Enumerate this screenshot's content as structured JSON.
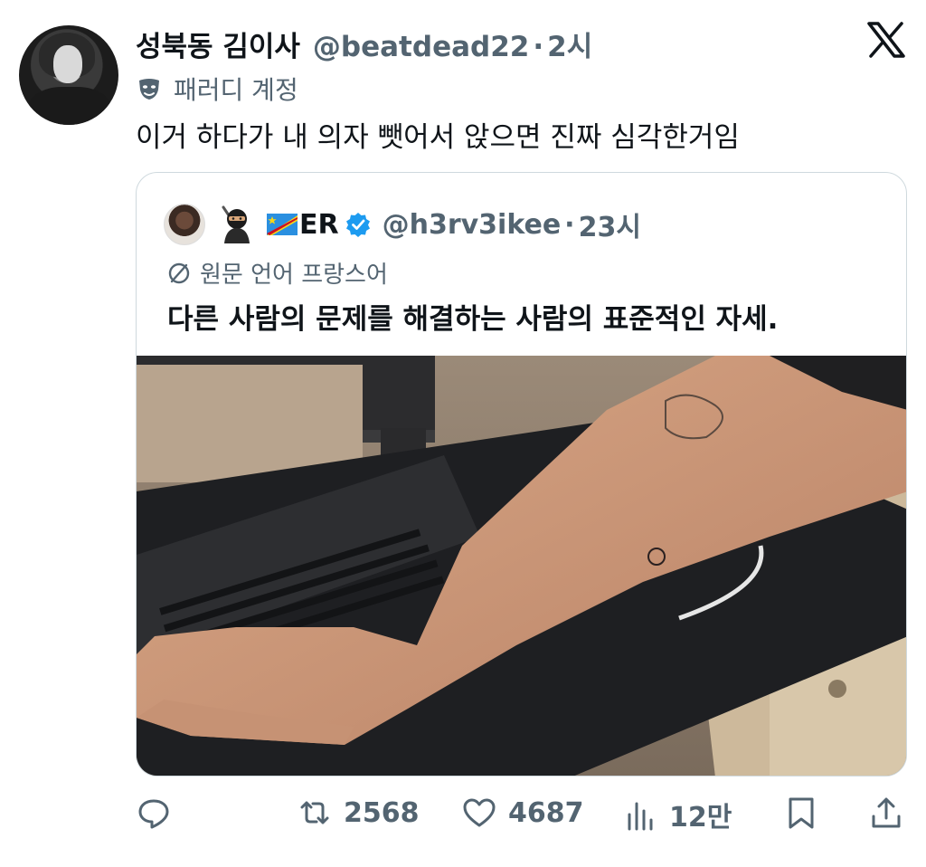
{
  "author": {
    "name": "성북동 김이사",
    "handle": "@beatdead22",
    "separator": "·",
    "time": "2시",
    "label": "패러디 계정"
  },
  "tweet": {
    "text": "이거 하다가 내 의자 뺏어서 앉으면 진짜 심각한거임"
  },
  "quoted": {
    "name": "ER",
    "handle": "@h3rv3ikee",
    "separator": "·",
    "time": "23시",
    "translated_label": "원문 언어 프랑스어",
    "text": "다른 사람의 문제를 해결하는 사람의 표준적인 자세."
  },
  "actions": {
    "retweets": "2568",
    "likes": "4687",
    "views": "12만"
  },
  "colors": {
    "text": "#0f1419",
    "secondary": "#536471",
    "border": "#cfd9de",
    "verified": "#1d9bf0"
  }
}
